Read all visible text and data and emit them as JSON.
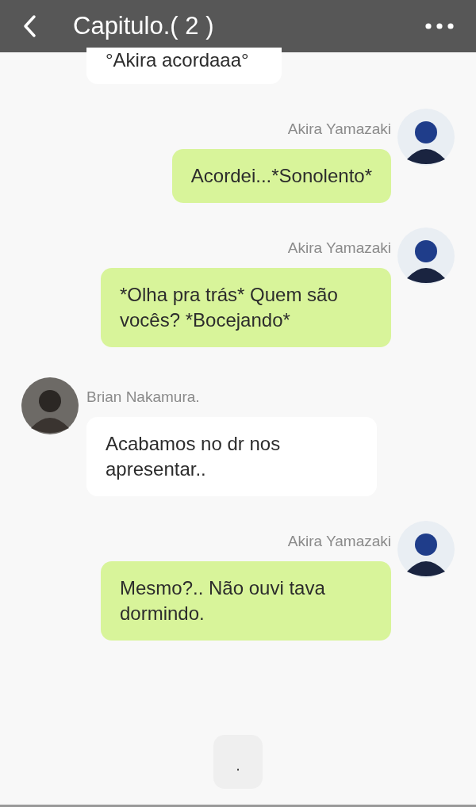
{
  "header": {
    "title": "Capitulo.( 2 )"
  },
  "messages": [
    {
      "kind": "partial",
      "text": "°Akira acordaaa°"
    },
    {
      "kind": "outgoing",
      "sender": "Akira Yamazaki",
      "text": "Acordei...*Sonolento*"
    },
    {
      "kind": "outgoing",
      "sender": "Akira Yamazaki",
      "text": "*Olha pra trás* Quem são vocês? *Bocejando*"
    },
    {
      "kind": "incoming",
      "sender": "Brian Nakamura.",
      "text": "Acabamos no dr nos apresentar.."
    },
    {
      "kind": "outgoing",
      "sender": "Akira Yamazaki",
      "text": "Mesmo?.. Não ouvi tava dormindo."
    }
  ],
  "footer": {
    "button": "."
  }
}
